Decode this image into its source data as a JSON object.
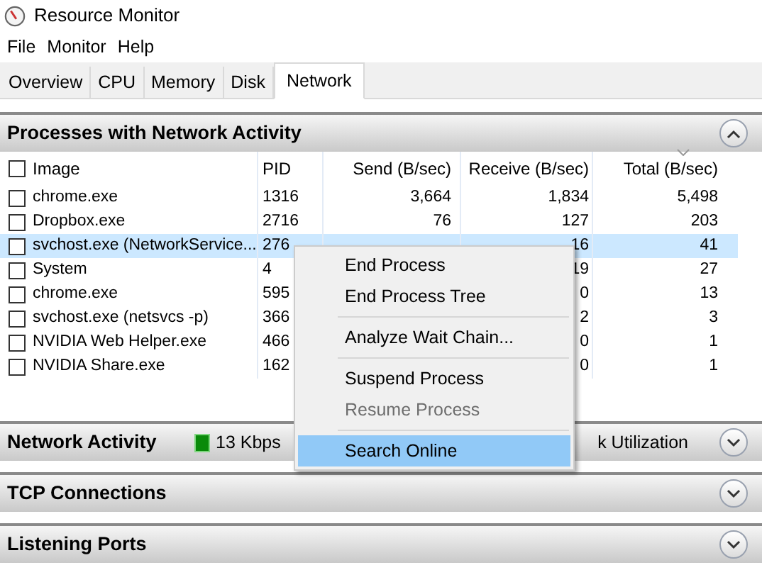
{
  "window": {
    "title": "Resource Monitor"
  },
  "menu_bar": [
    "File",
    "Monitor",
    "Help"
  ],
  "tabs": [
    {
      "label": "Overview",
      "selected": false
    },
    {
      "label": "CPU",
      "selected": false
    },
    {
      "label": "Memory",
      "selected": false
    },
    {
      "label": "Disk",
      "selected": false
    },
    {
      "label": "Network",
      "selected": true
    }
  ],
  "processes_section": {
    "title": "Processes with Network Activity",
    "expanded": true,
    "select_all_checked": false,
    "columns": [
      {
        "label": "Image",
        "sorted": false
      },
      {
        "label": "PID",
        "sorted": false
      },
      {
        "label": "Send (B/sec)",
        "sorted": false
      },
      {
        "label": "Receive (B/sec)",
        "sorted": false
      },
      {
        "label": "Total (B/sec)",
        "sorted": true
      }
    ],
    "rows": [
      {
        "checked": false,
        "selected": false,
        "cells": [
          "chrome.exe",
          "1316",
          "3,664",
          "1,834",
          "5,498"
        ]
      },
      {
        "checked": false,
        "selected": false,
        "cells": [
          "Dropbox.exe",
          "2716",
          "76",
          "127",
          "203"
        ]
      },
      {
        "checked": false,
        "selected": true,
        "cells": [
          "svchost.exe (NetworkService...",
          "276",
          "",
          "16",
          "41"
        ]
      },
      {
        "checked": false,
        "selected": false,
        "cells": [
          "System",
          "4",
          "",
          "19",
          "27"
        ]
      },
      {
        "checked": false,
        "selected": false,
        "cells": [
          "chrome.exe",
          "595",
          "",
          "0",
          "13"
        ]
      },
      {
        "checked": false,
        "selected": false,
        "cells": [
          "svchost.exe (netsvcs -p)",
          "366",
          "",
          "2",
          "3"
        ]
      },
      {
        "checked": false,
        "selected": false,
        "cells": [
          "NVIDIA Web Helper.exe",
          "466",
          "",
          "0",
          "1"
        ]
      },
      {
        "checked": false,
        "selected": false,
        "cells": [
          "NVIDIA Share.exe",
          "162",
          "",
          "0",
          "1"
        ]
      }
    ]
  },
  "collapsed_sections": [
    {
      "title": "Network Activity",
      "expanded": false,
      "summary": "13 Kbps",
      "summary_right": "k Utilization"
    },
    {
      "title": "TCP Connections",
      "expanded": false
    },
    {
      "title": "Listening Ports",
      "expanded": false
    }
  ],
  "context_menu": [
    {
      "kind": "item",
      "label": "End Process",
      "disabled": false,
      "selected": false
    },
    {
      "kind": "item",
      "label": "End Process Tree",
      "disabled": false,
      "selected": false
    },
    {
      "kind": "separator"
    },
    {
      "kind": "item",
      "label": "Analyze Wait Chain...",
      "disabled": false,
      "selected": false
    },
    {
      "kind": "separator"
    },
    {
      "kind": "item",
      "label": "Suspend Process",
      "disabled": false,
      "selected": false
    },
    {
      "kind": "item",
      "label": "Resume Process",
      "disabled": true,
      "selected": false
    },
    {
      "kind": "separator"
    },
    {
      "kind": "item",
      "label": "Search Online",
      "disabled": false,
      "selected": true
    }
  ]
}
